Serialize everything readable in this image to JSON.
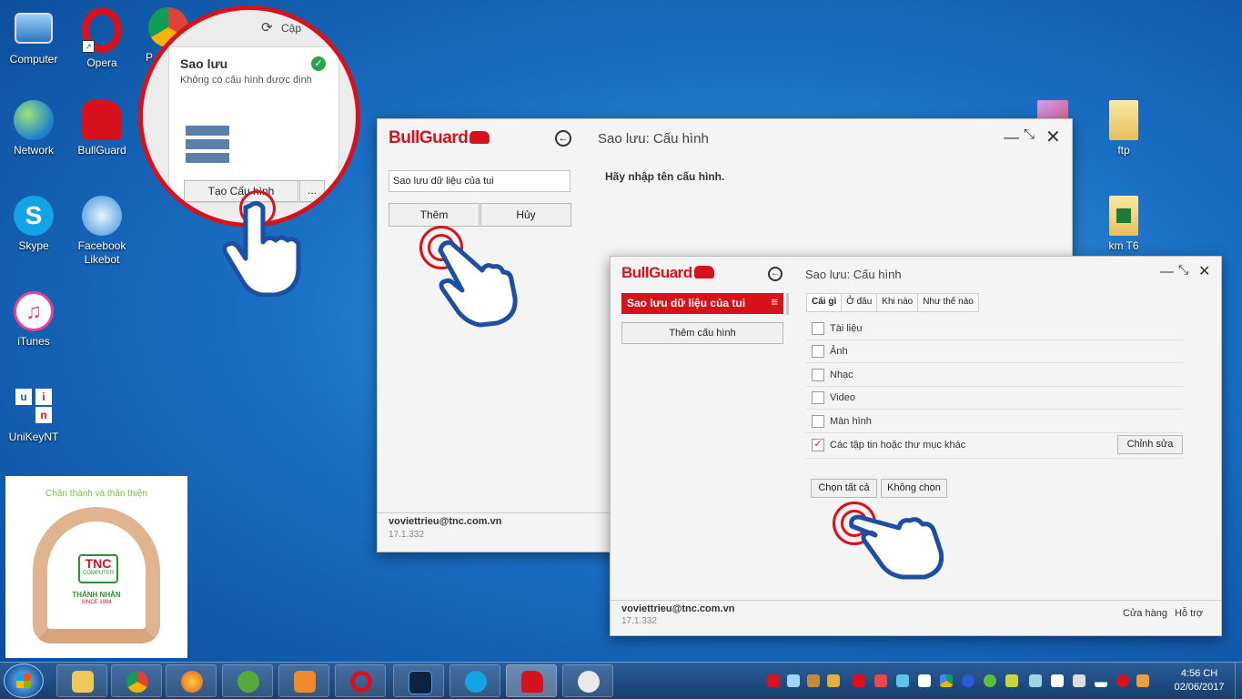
{
  "desktop": {
    "icons": [
      {
        "label": "Computer"
      },
      {
        "label": "Opera"
      },
      {
        "label": "P"
      },
      {
        "label": "Network"
      },
      {
        "label": "BullGuard"
      },
      {
        "label": "Skype"
      },
      {
        "label": "Facebook Likebot"
      },
      {
        "label": "iTunes"
      },
      {
        "label": "UniKeyNT"
      },
      {
        "label": "ftp"
      },
      {
        "label": "km T6"
      }
    ],
    "unikey_letters": [
      "u",
      "i",
      "n"
    ]
  },
  "zoom": {
    "update_label": "Cập",
    "card_title": "Sao lưu",
    "card_desc": "Không có cấu hình được định",
    "create_button": "Tạo Cấu hình",
    "more_button": "..."
  },
  "window1": {
    "logo": "BullGuard",
    "title": "Sao lưu: Cấu hình",
    "name_input_value": "Sao lưu dữ liệu của tui",
    "add_button": "Thêm",
    "cancel_button": "Hủy",
    "prompt": "Hãy nhập tên cấu hình.",
    "email": "voviettrieu@tnc.com.vn",
    "version": "17.1.332"
  },
  "window2": {
    "logo": "BullGuard",
    "title": "Sao lưu: Cấu hình",
    "config_item": "Sao lưu dữ liệu của tui",
    "add_config_button": "Thêm cấu hình",
    "tabs": [
      "Cái gì",
      "Ở đâu",
      "Khi nào",
      "Như thế nào"
    ],
    "options": [
      {
        "label": "Tài liệu",
        "checked": false
      },
      {
        "label": "Ảnh",
        "checked": false
      },
      {
        "label": "Nhạc",
        "checked": false
      },
      {
        "label": "Video",
        "checked": false
      },
      {
        "label": "Màn hình",
        "checked": false
      },
      {
        "label": "Các tập tin hoặc thư mục khác",
        "checked": true
      }
    ],
    "edit_button": "Chỉnh sửa",
    "select_all_button": "Chọn tất cả",
    "select_none_button": "Không chọn",
    "email": "voviettrieu@tnc.com.vn",
    "version": "17.1.332",
    "store_link": "Cửa hàng",
    "support_link": "Hỗ trợ"
  },
  "promo": {
    "slogan": "Chân thành và thân thiện",
    "logo_text": "TNC",
    "logo_sub": "COMPUTER",
    "company": "THÀNH NHÂN",
    "since": "SINCE 1994"
  },
  "taskbar": {
    "time": "4:56 CH",
    "date": "02/06/2017"
  },
  "colors": {
    "brand_red": "#d8121c",
    "hand_blue": "#1c4fa1"
  }
}
